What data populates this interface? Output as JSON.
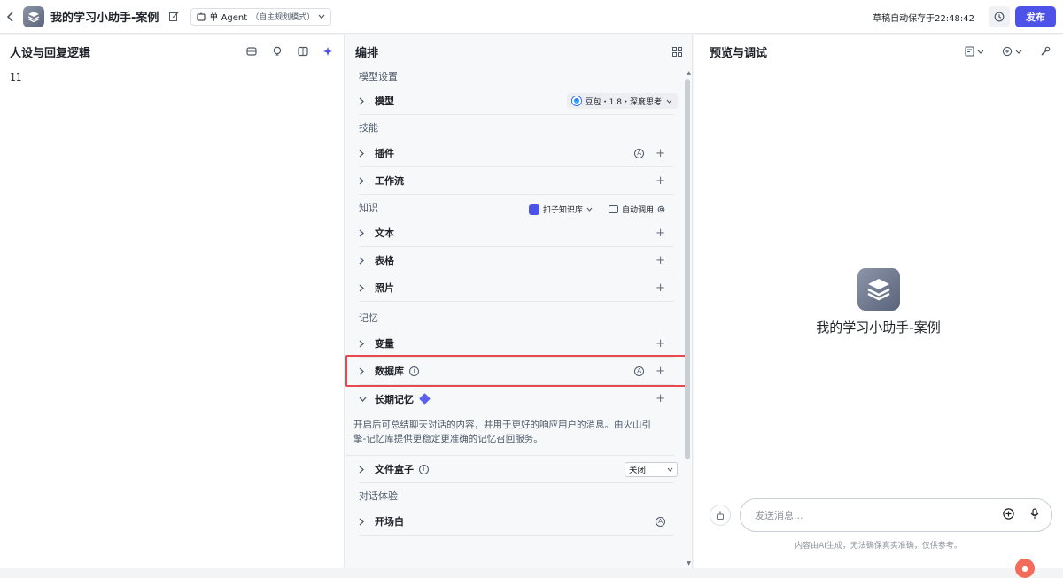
{
  "header": {
    "back_icon": "chevron-left-icon",
    "app_title": "我的学习小助手-案例",
    "mode_label": "单 Agent",
    "mode_sub": "（自主规划模式）",
    "autosave": "草稿自动保存于22:48:42",
    "publish_label": "发布"
  },
  "left": {
    "title": "人设与回复逻辑",
    "prompt_text": "11"
  },
  "mid": {
    "title": "编排",
    "model_section": "模型设置",
    "model_label": "模型",
    "model_value": "豆包・1.8・深度思考",
    "skills_section": "技能",
    "plugins_label": "插件",
    "workflow_label": "工作流",
    "knowledge_section": "知识",
    "kb_source": "扣子知识库",
    "kb_mode": "自动调用",
    "text_label": "文本",
    "table_label": "表格",
    "photo_label": "照片",
    "memory_section": "记忆",
    "variables_label": "变量",
    "database_label": "数据库",
    "ltm_label": "长期记忆",
    "ltm_desc": "开启后可总结聊天对话的内容，并用于更好的响应用户的消息。由火山引擎-记忆库提供更稳定更准确的记忆召回服务。",
    "filebox_label": "文件盒子",
    "filebox_value": "关闭",
    "dialog_section": "对话体验",
    "opening_label": "开场白"
  },
  "right": {
    "title": "预览与调试",
    "bot_name": "我的学习小助手-案例",
    "input_placeholder": "发送消息...",
    "disclaimer": "内容由AI生成，无法确保真实准确，仅供参考。"
  },
  "colors": {
    "accent": "#4d53e8",
    "highlight": "#e8484f"
  }
}
